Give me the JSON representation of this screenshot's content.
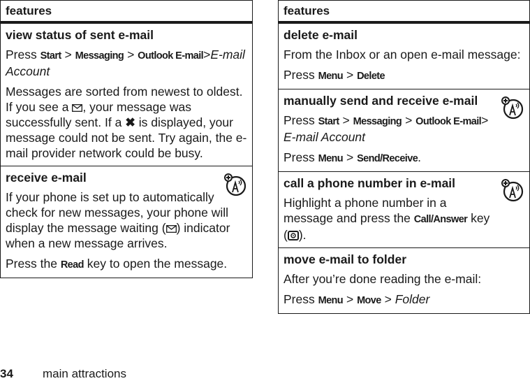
{
  "left_table": {
    "header": "features",
    "rows": [
      {
        "title": "view status of sent e-mail",
        "press": "Press",
        "keys": [
          "Start",
          "Messaging",
          "Outlook E-mail"
        ],
        "sep": ">",
        "italic": "E-mail Account",
        "body_a": "Messages are sorted from newest to oldest. If you see a",
        "body_b": ", your message was successfully sent. If a",
        "x_glyph": "✖",
        "body_c": "is displayed, your message could not be sent. Try again, the e-mail provider network could be busy."
      },
      {
        "title": "receive e-mail",
        "icon": "network-icon",
        "body_a": "If your phone is set up to automatically check for new messages, your phone will display the message waiting (",
        "body_b": ") indicator when a new message arrives.",
        "press": "Press the",
        "key": "Read",
        "press_end": "key to open the message."
      }
    ]
  },
  "right_table": {
    "header": "features",
    "rows": [
      {
        "title": "delete e-mail",
        "body": "From the Inbox or an open e-mail message:",
        "press": "Press",
        "keys": [
          "Menu",
          "Delete"
        ],
        "sep": ">"
      },
      {
        "title": "manually send and receive e-mail",
        "icon": "network-icon",
        "press": "Press",
        "keys": [
          "Start",
          "Messaging",
          "Outlook E-mail"
        ],
        "sep": ">",
        "italic": "E-mail Account",
        "press2": "Press",
        "keys2": [
          "Menu",
          "Send/Receive"
        ],
        "end": "."
      },
      {
        "title": "call a phone number in e-mail",
        "icon": "network-icon",
        "body_a": "Highlight a phone number in a message and press the",
        "key": "Call/Answer",
        "body_b": "key (",
        "body_c": ")."
      },
      {
        "title": "move e-mail to folder",
        "body": "After you’re done reading the e-mail:",
        "press": "Press",
        "keys": [
          "Menu",
          "Move"
        ],
        "sep": ">",
        "italic": "Folder"
      }
    ]
  },
  "footer": {
    "page_number": "34",
    "section": "main attractions"
  }
}
